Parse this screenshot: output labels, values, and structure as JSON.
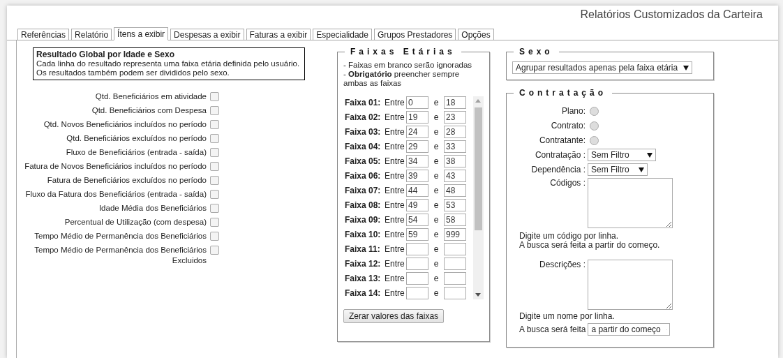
{
  "header": {
    "title": "Relatórios Customizados da Carteira"
  },
  "tabs": [
    {
      "label": "Referências",
      "selected": false
    },
    {
      "label": "Relatório",
      "selected": false
    },
    {
      "label": "Ítens a exibir",
      "selected": true
    },
    {
      "label": "Despesas a exibir",
      "selected": false
    },
    {
      "label": "Faturas a exibir",
      "selected": false
    },
    {
      "label": "Especialidade",
      "selected": false
    },
    {
      "label": "Grupos Prestadores",
      "selected": false
    },
    {
      "label": "Opções",
      "selected": false
    }
  ],
  "summary": {
    "title": "Resultado Global por Idade e Sexo",
    "lines": [
      "Cada linha do resultado representa uma faixa etária definida pelo usuário.",
      "Os resultados também podem ser divididos pelo sexo."
    ]
  },
  "items": [
    {
      "label": "Qtd. Beneficiários em atividade",
      "checked": false
    },
    {
      "label": "Qtd. Beneficiários com Despesa",
      "checked": false
    },
    {
      "label": "Qtd. Novos Beneficiários incluídos no período",
      "checked": false
    },
    {
      "label": "Qtd. Beneficiários excluídos no período",
      "checked": false
    },
    {
      "label": "Fluxo de Beneficiários (entrada - saída)",
      "checked": false
    },
    {
      "label": "Fatura de Novos Beneficiários incluídos no período",
      "checked": false
    },
    {
      "label": "Fatura de Beneficiários excluídos no período",
      "checked": false
    },
    {
      "label": "Fluxo da Fatura dos Beneficiários (entrada - saída)",
      "checked": false
    },
    {
      "label": "Idade Média dos Beneficiários",
      "checked": false
    },
    {
      "label": "Percentual de Utilização (com despesa)",
      "checked": false
    },
    {
      "label": "Tempo Médio de Permanência dos Beneficiários",
      "checked": false
    },
    {
      "label": "Tempo Médio de Permanência dos Beneficiários Excluidos",
      "checked": false
    }
  ],
  "age_bands": {
    "legend": "Faixas Etárias",
    "notes": [
      "- Faixas em branco serão ignoradas",
      "- **Obrigatório** preencher sempre ambas as faixas"
    ],
    "rows": [
      {
        "label": "Faixa 01:",
        "between": "Entre",
        "from": "0",
        "and": "e",
        "to": "18"
      },
      {
        "label": "Faixa 02:",
        "between": "Entre",
        "from": "19",
        "and": "e",
        "to": "23"
      },
      {
        "label": "Faixa 03:",
        "between": "Entre",
        "from": "24",
        "and": "e",
        "to": "28"
      },
      {
        "label": "Faixa 04:",
        "between": "Entre",
        "from": "29",
        "and": "e",
        "to": "33"
      },
      {
        "label": "Faixa 05:",
        "between": "Entre",
        "from": "34",
        "and": "e",
        "to": "38"
      },
      {
        "label": "Faixa 06:",
        "between": "Entre",
        "from": "39",
        "and": "e",
        "to": "43"
      },
      {
        "label": "Faixa 07:",
        "between": "Entre",
        "from": "44",
        "and": "e",
        "to": "48"
      },
      {
        "label": "Faixa 08:",
        "between": "Entre",
        "from": "49",
        "and": "e",
        "to": "53"
      },
      {
        "label": "Faixa 09:",
        "between": "Entre",
        "from": "54",
        "and": "e",
        "to": "58"
      },
      {
        "label": "Faixa 10:",
        "between": "Entre",
        "from": "59",
        "and": "e",
        "to": "999"
      },
      {
        "label": "Faixa 11:",
        "between": "Entre",
        "and": "e"
      },
      {
        "label": "Faixa 12:",
        "between": "Entre",
        "and": "e"
      },
      {
        "label": "Faixa 13:",
        "between": "Entre",
        "and": "e"
      },
      {
        "label": "Faixa 14:",
        "between": "Entre",
        "and": "e"
      }
    ],
    "reset_button": "Zerar valores das faixas"
  },
  "sex": {
    "legend": "Sexo",
    "select": "Agrupar resultados apenas pela faixa etária"
  },
  "contracting": {
    "legend": "Contratação",
    "radios": [
      {
        "label": "Plano:",
        "selected": false
      },
      {
        "label": "Contrato:",
        "selected": false
      },
      {
        "label": "Contratante:",
        "selected": false
      }
    ],
    "selects": [
      {
        "label": "Contratação :",
        "value": "Sem Filtro"
      },
      {
        "label": "Dependência :",
        "value": "Sem Filtro"
      }
    ],
    "codes": {
      "label": "Códigos :",
      "hint": [
        "Digite um código por linha.",
        "A busca será feita a partir do começo."
      ]
    },
    "descriptions": {
      "label": "Descrições :",
      "hint": "Digite um nome por linha.",
      "search_label": "A busca será feita",
      "search_select": "a partir do começo"
    }
  }
}
